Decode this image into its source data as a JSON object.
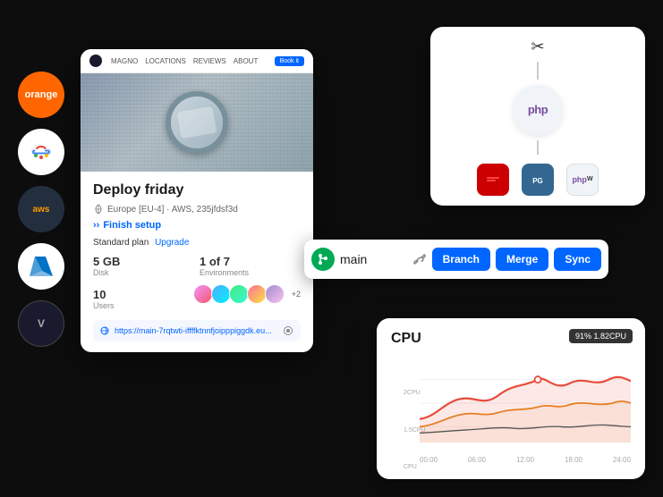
{
  "cloud_logos": [
    {
      "name": "orange",
      "label": "orange",
      "class": "logo-orange"
    },
    {
      "name": "google-cloud",
      "label": "G",
      "class": "logo-gcloud"
    },
    {
      "name": "aws",
      "label": "aws",
      "class": "logo-aws"
    },
    {
      "name": "azure",
      "label": "Az",
      "class": "logo-azure"
    },
    {
      "name": "vm",
      "label": "V",
      "class": "logo-vm"
    }
  ],
  "deploy_card": {
    "title": "Deploy friday",
    "region": "Europe [EU-4] · AWS, 235jfdsf3d",
    "finish_setup": "Finish setup",
    "plan_label": "Standard plan",
    "upgrade_label": "Upgrade",
    "disk_value": "5 GB",
    "disk_label": "Disk",
    "env_value": "1 of 7",
    "env_label": "Environments",
    "users_count": "10",
    "users_label": "Users",
    "users_extra": "+2",
    "url": "https://main-7rqtwti-iffffktnnfjoipppiggdk.eu...",
    "nav_items": [
      "MAGNO",
      "LOCATIONS",
      "REVIEWS",
      "ABOUT"
    ],
    "nav_btn": "Book it"
  },
  "workflow": {
    "scissors_symbol": "✂",
    "php_label": "php",
    "php_w_label": "php W",
    "redis_label": "R",
    "pg_label": "DB"
  },
  "branch_bar": {
    "branch_name": "main",
    "branch_btn": "Branch",
    "merge_btn": "Merge",
    "sync_btn": "Sync"
  },
  "cpu_chart": {
    "title": "CPU",
    "tooltip": "91% 1.82CPU",
    "y_labels": [
      "2CPU",
      "1.5CPU",
      "CPU"
    ],
    "x_labels": [
      "00:00",
      "06:00",
      "12:00",
      "18:00",
      "24:00"
    ]
  }
}
